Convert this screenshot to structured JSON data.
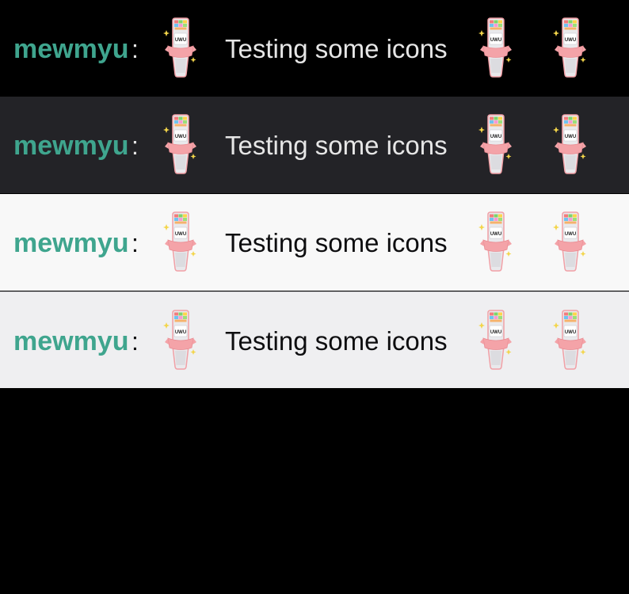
{
  "chat_rows": [
    {
      "theme": "dark-black",
      "background": "#000000",
      "text_color": "#e6e6e6",
      "username": "mewmyu",
      "username_color": "#3fa58e",
      "separator": ":",
      "message": "Testing some icons",
      "emote_icons": [
        "uwu-cup-emote-icon",
        "uwu-cup-emote-icon",
        "uwu-cup-emote-icon"
      ]
    },
    {
      "theme": "dark-gray",
      "background": "#232327",
      "text_color": "#e6e6e6",
      "username": "mewmyu",
      "username_color": "#3fa58e",
      "separator": ":",
      "message": "Testing some icons",
      "emote_icons": [
        "uwu-cup-emote-icon",
        "uwu-cup-emote-icon",
        "uwu-cup-emote-icon"
      ]
    },
    {
      "theme": "light-white",
      "background": "#f8f8f8",
      "text_color": "#0e0e10",
      "username": "mewmyu",
      "username_color": "#3fa58e",
      "separator": ":",
      "message": "Testing some icons",
      "emote_icons": [
        "uwu-cup-emote-icon",
        "uwu-cup-emote-icon",
        "uwu-cup-emote-icon"
      ]
    },
    {
      "theme": "light-gray",
      "background": "#efeff1",
      "text_color": "#0e0e10",
      "username": "mewmyu",
      "username_color": "#3fa58e",
      "separator": ":",
      "message": "Testing some icons",
      "emote_icons": [
        "uwu-cup-emote-icon",
        "uwu-cup-emote-icon",
        "uwu-cup-emote-icon"
      ]
    }
  ],
  "emote": {
    "label": "UWU"
  },
  "colors": {
    "page_background": "#000000",
    "username": "#3fa58e",
    "emote_pink": "#f4a3a8",
    "emote_cup": "#e9e9ec",
    "sparkle": "#f3d54a"
  }
}
